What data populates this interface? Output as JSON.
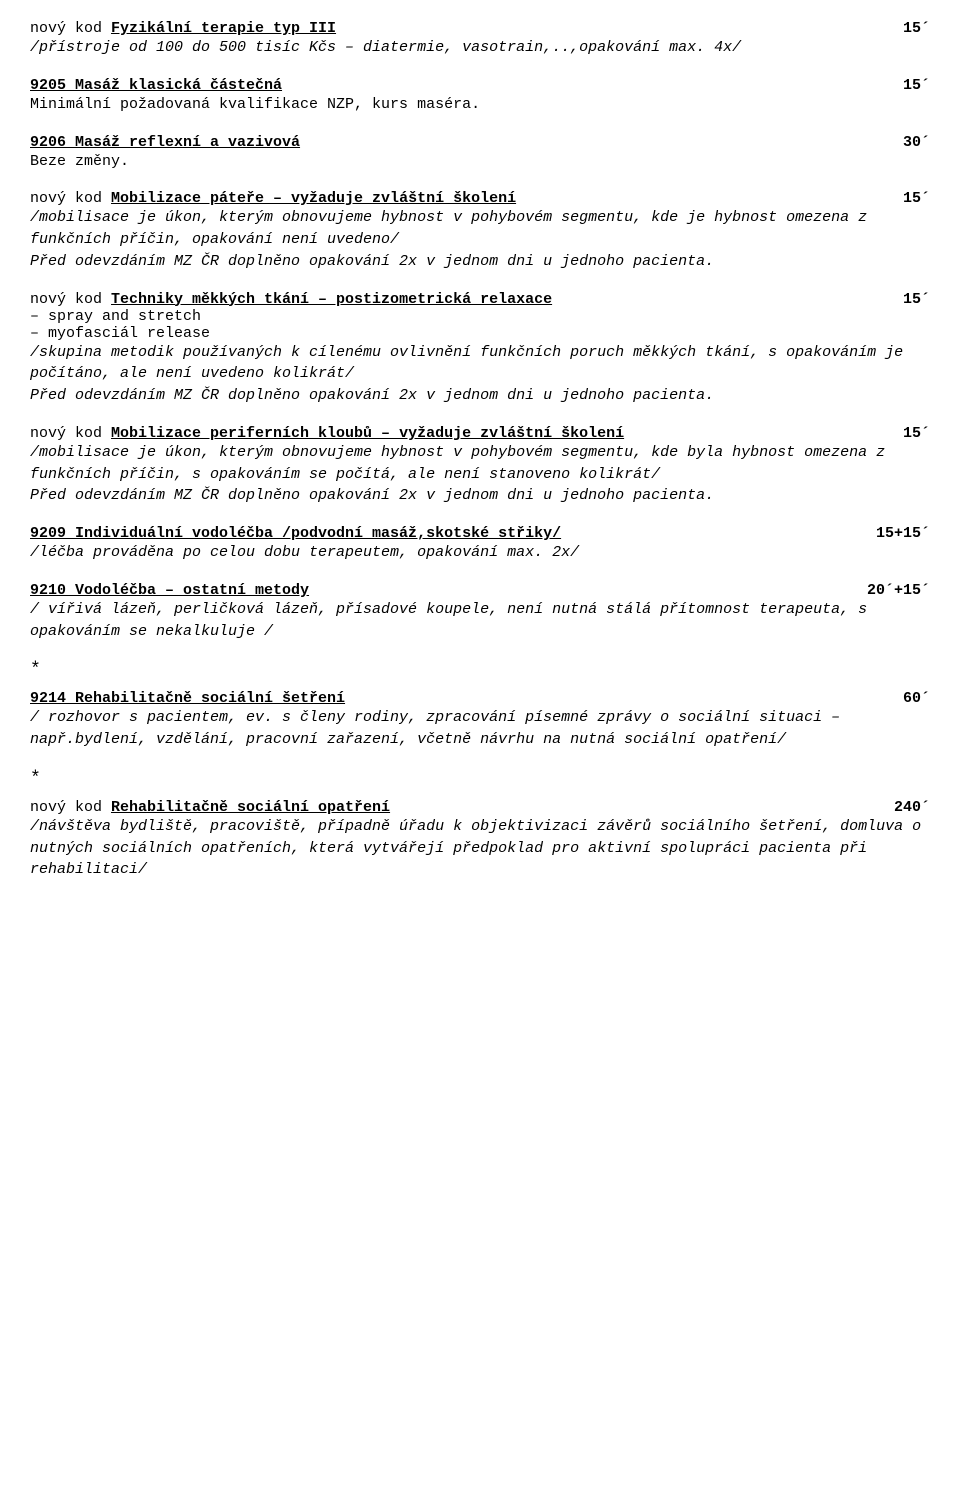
{
  "sections": [
    {
      "id": "fyz-terapie",
      "prefix": "nový kod",
      "title_bold_underline": "Fyzikální terapie typ III",
      "title_rest": "",
      "time": "15´",
      "body_italic": "/přístroje od 100 do 500 tisíc Kčs – diatermie, vasotrain,..,opakování max. 4x/"
    },
    {
      "id": "masaz-klasicka",
      "prefix": "9205",
      "title_bold_underline": "Masáž klasická částečná",
      "title_rest": "",
      "time": "15´",
      "body_italic": "Minimální požadovaná kvalifikace NZP, kurs maséra."
    },
    {
      "id": "masaz-reflexni",
      "prefix": "9206",
      "title_bold_underline": "Masáž reflexní a vazivová",
      "title_rest": "",
      "time": "30´",
      "body_italic": "Beze změny."
    },
    {
      "id": "mobilizace-patere",
      "prefix": "nový kod",
      "title_bold_underline": "Mobilizace páteře – vyžaduje zvláštní školení",
      "title_rest": "",
      "time": "15´",
      "body_italic": "/mobilisace je úkon, kterým obnovujeme hybnost v pohybovém segmentu, kde je hybnost omezena z funkčních příčin, opakování není uvedeno/\nPřed odevzdáním MZ ČR doplněno opakování 2x v jednom dni u jednoho pacienta."
    },
    {
      "id": "techniky-mek",
      "prefix": "nový kod",
      "title_bold_underline": "Techniky měkkých tkání – postizometrická relaxace",
      "title_sub1": "– spray and stretch",
      "title_sub2": "– myofasciál release",
      "time": "15´",
      "body_italic": "/skupina metodik používaných k cílenému ovlivnění funkčních poruch měkkých tkání, s opakováním je počítáno, ale není uvedeno kolikrát/\nPřed odevzdáním MZ ČR doplněno opakování 2x v jednom dni u jednoho pacienta."
    },
    {
      "id": "mobilizace-periferních",
      "prefix": "nový kod",
      "title_bold_underline": "Mobilizace periferních kloubů – vyžaduje zvláštní školení",
      "title_rest": "",
      "time": "15´",
      "body_italic": "/mobilisace je úkon, kterým obnovujeme hybnost v pohybovém segmentu, kde byla hybnost omezena z funkčních příčin, s opakováním se počítá, ale není stanoveno kolikrát/\nPřed odevzdáním MZ ČR doplněno opakování 2x v jednom dni u jednoho pacienta."
    },
    {
      "id": "vodolechba-individualni",
      "prefix": "9209",
      "title_bold_underline": "Individuální vodoléčba /podvodní masáž,skotské střiky/",
      "title_rest": "",
      "time": "15+15´",
      "body_italic": "/léčba prováděna po celou dobu terapeutem, opakování max. 2x/"
    },
    {
      "id": "vodolechba-ostatni",
      "prefix": "9210",
      "title_bold_underline": "Vodoléčba – ostatní metody",
      "title_rest": "",
      "time": "20´+15´",
      "body_italic": "/ vířivá lázeň, perličková lázeň, přísadové koupele, není nutná stálá přítomnost terapeuta, s opakováním se nekalkuluje /"
    },
    {
      "id": "star1",
      "type": "star"
    },
    {
      "id": "rehabilitacni-social-setreni",
      "prefix": "9214",
      "title_bold_underline": "Rehabilitačně sociální šetření",
      "title_rest": "",
      "time": "60´",
      "body_italic": "/ rozhovor s pacientem, ev. s členy rodiny, zpracování písemné zprávy o sociální situaci – např.bydlení, vzdělání, pracovní zařazení, včetně návrhu na nutná sociální opatření/"
    },
    {
      "id": "star2",
      "type": "star"
    },
    {
      "id": "rehabilitacni-social-opatreni",
      "prefix": "nový kod",
      "title_bold_underline": "Rehabilitačně sociální opatření",
      "title_rest": "",
      "time": "240´",
      "body_italic": "/návštěva bydliště, pracoviště, případně úřadu k objektivizaci závěrů sociálního šetření, domluva o nutných sociálních opatřeních, která vytvářejí předpoklad pro aktivní spolupráci pacienta při rehabilitaci/"
    }
  ],
  "labels": {
    "novy_kod": "nový kod",
    "star": "*"
  }
}
